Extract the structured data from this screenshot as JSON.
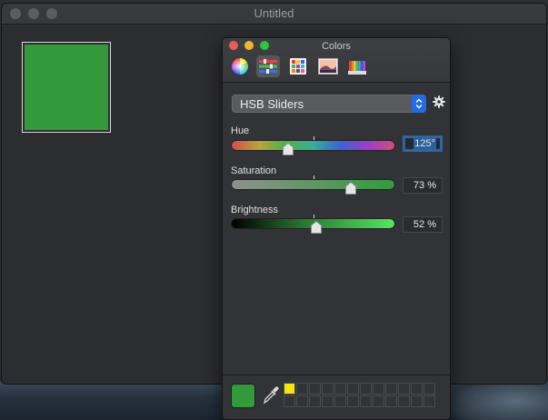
{
  "document_window": {
    "title": "Untitled",
    "well_color": "#339a3c"
  },
  "colors_panel": {
    "title": "Colors",
    "modes": [
      {
        "name": "color-wheel-icon",
        "active": false
      },
      {
        "name": "sliders-icon",
        "active": true
      },
      {
        "name": "palettes-icon",
        "active": false
      },
      {
        "name": "image-palettes-icon",
        "active": false
      },
      {
        "name": "pencils-icon",
        "active": false
      }
    ],
    "slider_mode": "HSB Sliders",
    "sliders": [
      {
        "label": "Hue",
        "value_text": "125°",
        "fraction": 0.347,
        "focused": true
      },
      {
        "label": "Saturation",
        "value_text": "73 %",
        "fraction": 0.73,
        "focused": false
      },
      {
        "label": "Brightness",
        "value_text": "52 %",
        "fraction": 0.52,
        "focused": false
      }
    ],
    "current_color": "#339a3c",
    "swatches": {
      "rows": 2,
      "columns": 12,
      "filled": [
        {
          "index": 0,
          "color": "#f5e50a"
        }
      ]
    }
  }
}
